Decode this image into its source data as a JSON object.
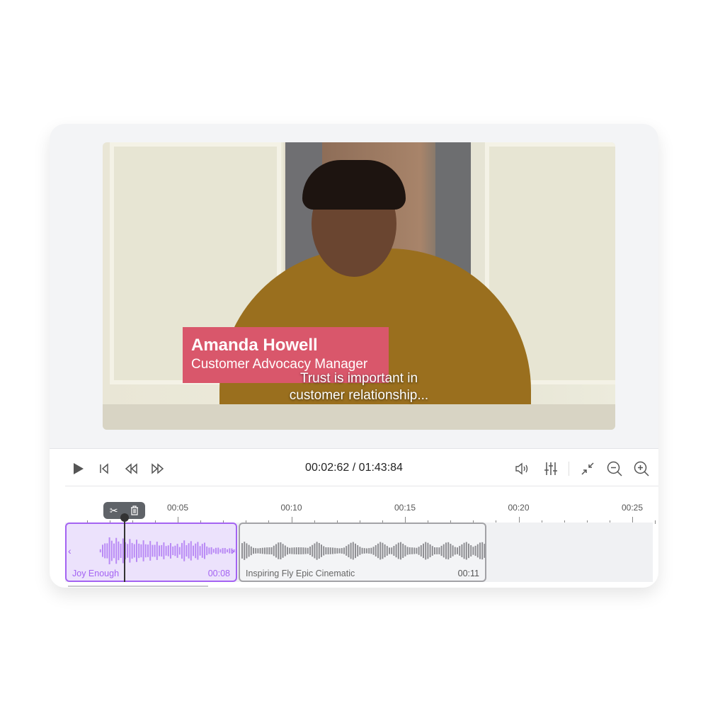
{
  "video": {
    "lower_third": {
      "name": "Amanda Howell",
      "role": "Customer Advocacy Manager",
      "color": "#d9576b"
    },
    "subtitle_line1": "Trust is important in",
    "subtitle_line2": "customer relationship..."
  },
  "controls": {
    "current_time": "00:02:62",
    "total_time": "01:43:84",
    "time_display": "00:02:62 / 01:43:84",
    "left_icons": [
      "play-icon",
      "skip-back-icon",
      "rewind-icon",
      "fast-forward-icon"
    ],
    "right_icons": [
      "volume-icon",
      "equalizer-icon",
      "collapse-icon",
      "zoom-out-icon",
      "zoom-in-icon"
    ]
  },
  "timeline": {
    "ruler_labels": [
      "00:05",
      "00:10",
      "00:15",
      "00:20",
      "00:25"
    ],
    "clip_toolbar_icons": [
      "scissors-icon",
      "trash-icon"
    ],
    "clips": [
      {
        "name": "Joy Enough",
        "duration": "00:08",
        "color": "#a463f2",
        "selected": true
      },
      {
        "name": "Inspiring Fly Epic Cinematic",
        "duration": "00:11",
        "color": "#8e8e92",
        "selected": false
      }
    ]
  }
}
